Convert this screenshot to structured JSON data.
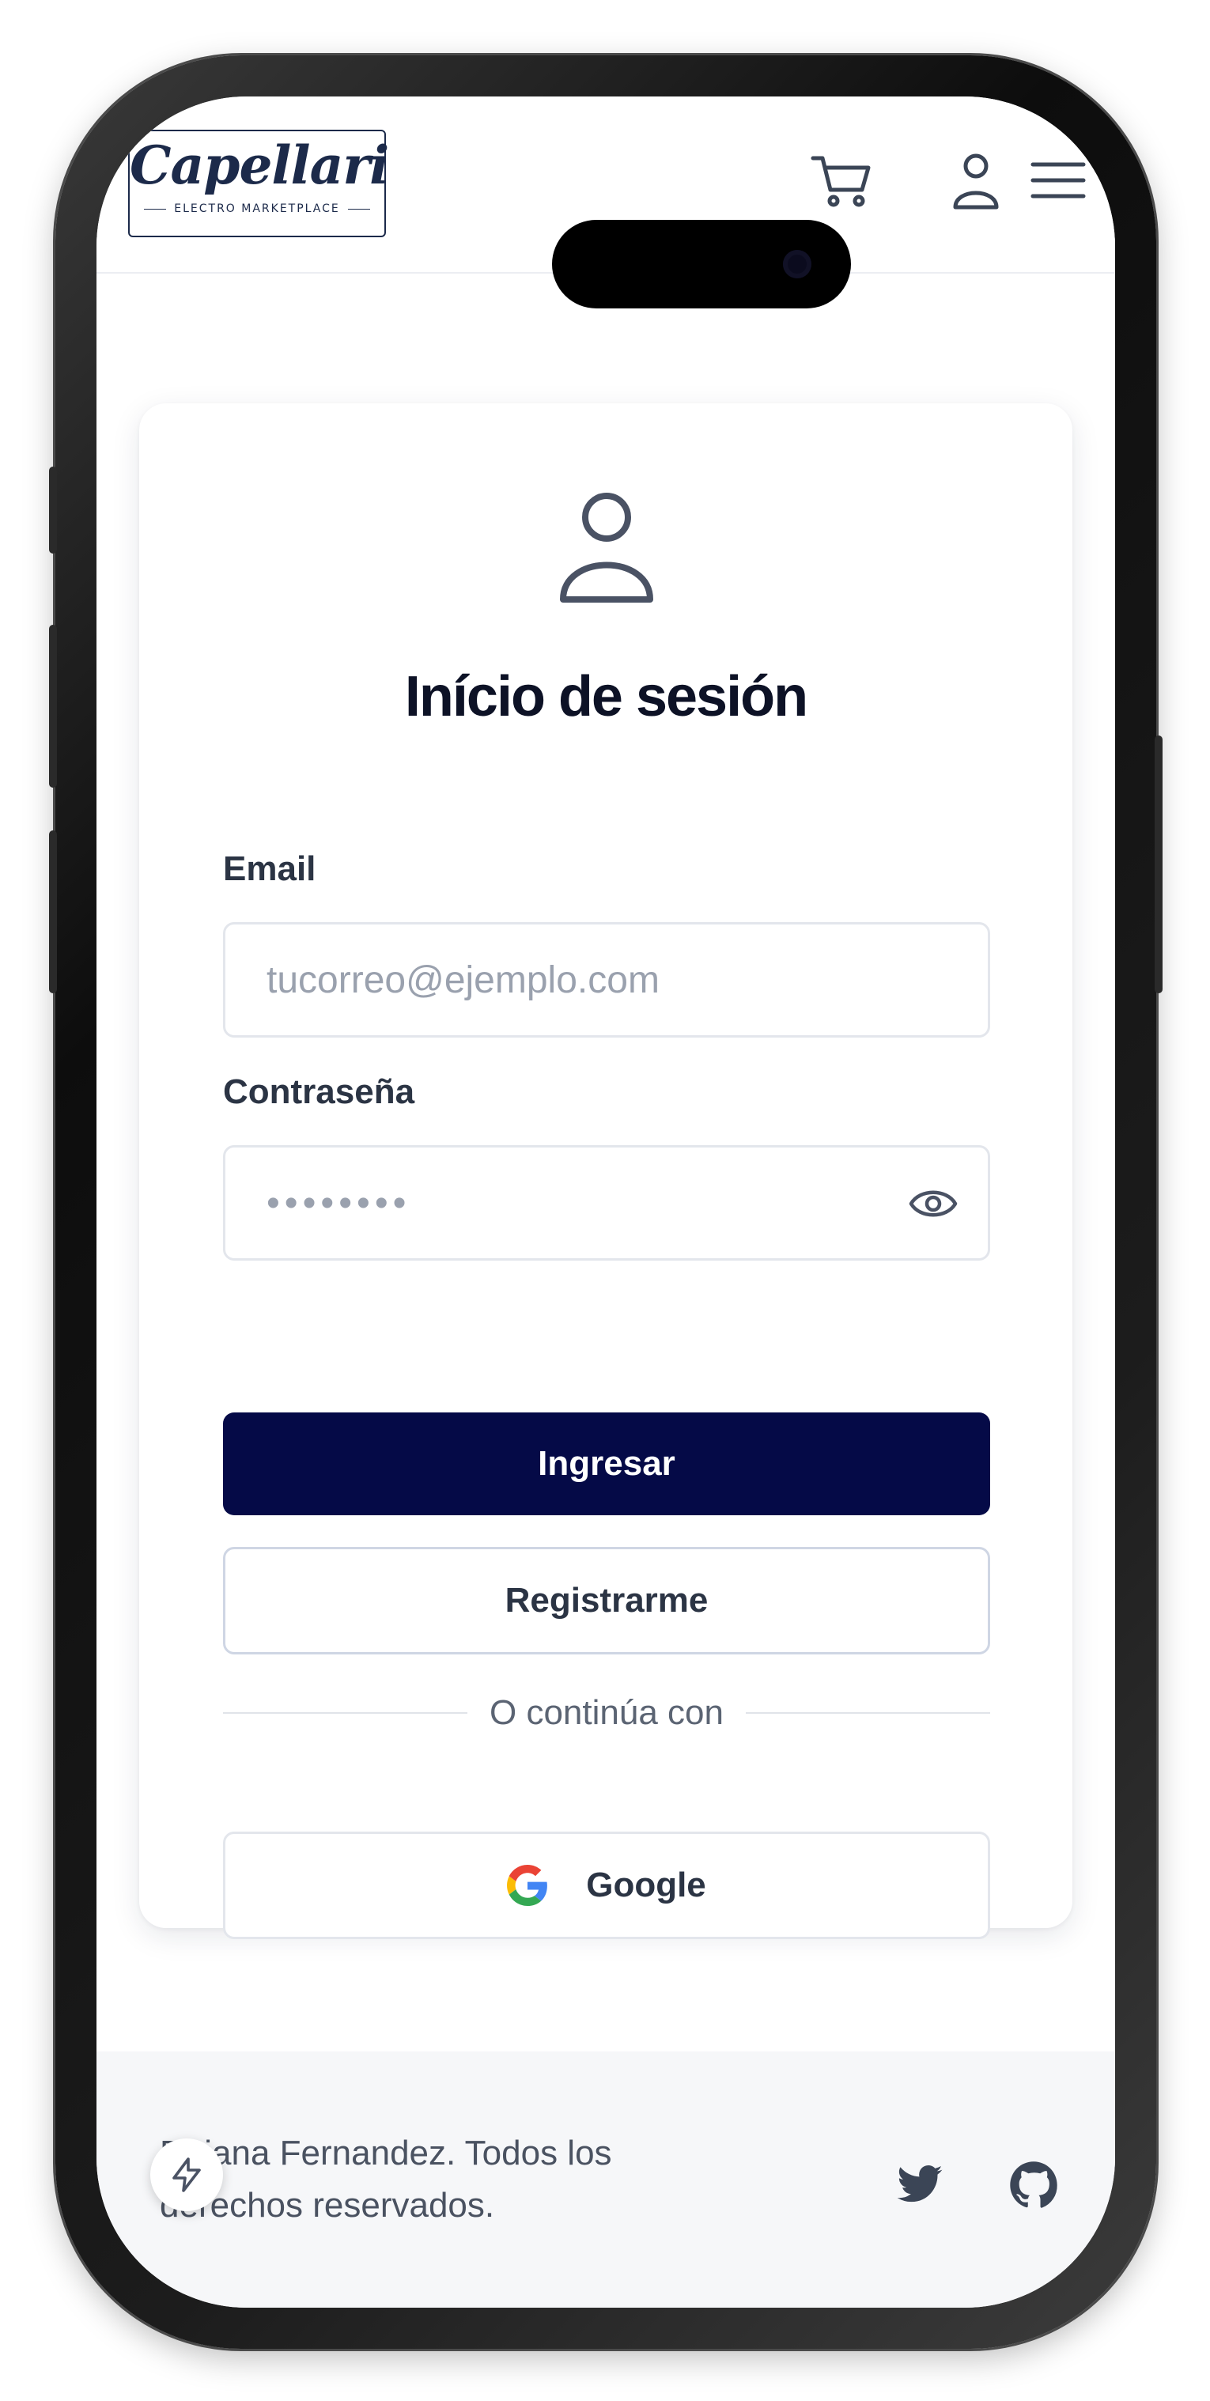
{
  "header": {
    "logo_name": "Capellari",
    "logo_tagline": "ELECTRO MARKETPLACE",
    "icons": [
      "cart-icon",
      "user-icon",
      "menu-icon"
    ]
  },
  "login": {
    "title": "Início de sesión",
    "email_label": "Email",
    "email_placeholder": "tucorreo@ejemplo.com",
    "password_label": "Contraseña",
    "password_value": "••••••••",
    "submit_label": "Ingresar",
    "register_label": "Registrarme",
    "divider_text": "O continúa con",
    "google_label": "Google"
  },
  "footer": {
    "copyright": "Daiana Fernandez. Todos los derechos reservados.",
    "social_icons": [
      "twitter-icon",
      "github-icon"
    ]
  },
  "colors": {
    "primary": "#050a47",
    "title_text": "#0d1226",
    "border": "#e3e6ec",
    "footer_bg": "#f6f7f9"
  }
}
